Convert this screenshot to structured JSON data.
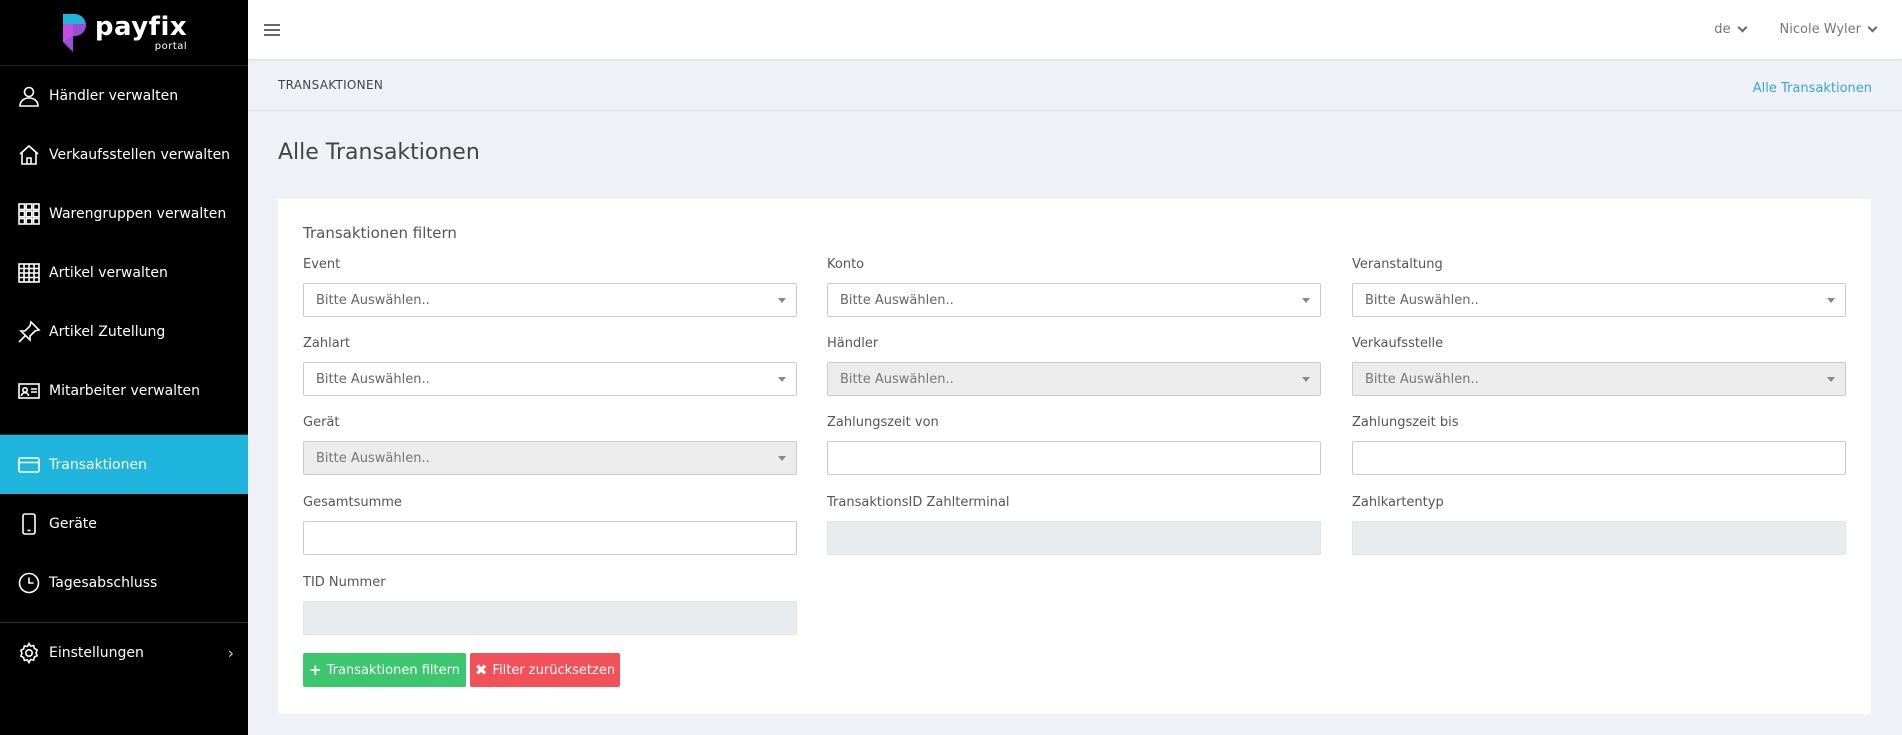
{
  "brand": {
    "name": "payfix",
    "subtitle": "portal"
  },
  "sidebar": {
    "items": [
      {
        "label": "Händler verwalten",
        "icon": "user-icon"
      },
      {
        "label": "Verkaufsstellen verwalten",
        "icon": "home-icon"
      },
      {
        "label": "Warengruppen verwalten",
        "icon": "grid-icon"
      },
      {
        "label": "Artikel verwalten",
        "icon": "table-grid-icon"
      },
      {
        "label": "Artikel Zutellung",
        "icon": "pin-icon"
      },
      {
        "label": "Mitarbeiter verwalten",
        "icon": "id-card-icon"
      },
      {
        "label": "Transaktionen",
        "icon": "credit-card-icon",
        "active": true
      },
      {
        "label": "Geräte",
        "icon": "phone-icon"
      },
      {
        "label": "Tagesabschluss",
        "icon": "clock-icon"
      },
      {
        "label": "Einstellungen",
        "icon": "gear-icon"
      }
    ]
  },
  "topbar": {
    "language": "de",
    "user": "Nicole Wyler"
  },
  "breadcrumb": {
    "current": "TRANSAKTIONEN",
    "link": "Alle Transaktionen"
  },
  "page": {
    "title": "Alle Transaktionen"
  },
  "filter": {
    "title": "Transaktionen filtern",
    "fields": {
      "event": {
        "label": "Event",
        "value": "Bitte Auswählen.."
      },
      "konto": {
        "label": "Konto",
        "value": "Bitte Auswählen.."
      },
      "veranstaltung": {
        "label": "Veranstaltung",
        "value": "Bitte Auswählen.."
      },
      "zahlart": {
        "label": "Zahlart",
        "value": "Bitte Auswählen.."
      },
      "haendler": {
        "label": "Händler",
        "value": "Bitte Auswählen.."
      },
      "verkaufsstelle": {
        "label": "Verkaufsstelle",
        "value": "Bitte Auswählen.."
      },
      "geraet": {
        "label": "Gerät",
        "value": "Bitte Auswählen.."
      },
      "zahlungszeit_von": {
        "label": "Zahlungszeit von",
        "value": ""
      },
      "zahlungszeit_bis": {
        "label": "Zahlungszeit bis",
        "value": ""
      },
      "gesamtsumme": {
        "label": "Gesamtsumme",
        "value": ""
      },
      "transaktions_id": {
        "label": "TransaktionsID Zahlterminal",
        "value": ""
      },
      "zahlkartentyp": {
        "label": "Zahlkartentyp",
        "value": ""
      },
      "tid_nummer": {
        "label": "TID Nummer",
        "value": ""
      }
    },
    "buttons": {
      "apply": "Transaktionen filtern",
      "reset": "Filter zurücksetzen"
    }
  },
  "colors": {
    "accent": "#1fb5dd",
    "apply": "#3cc66e",
    "reset": "#f15159",
    "link": "#3aa6d8"
  }
}
